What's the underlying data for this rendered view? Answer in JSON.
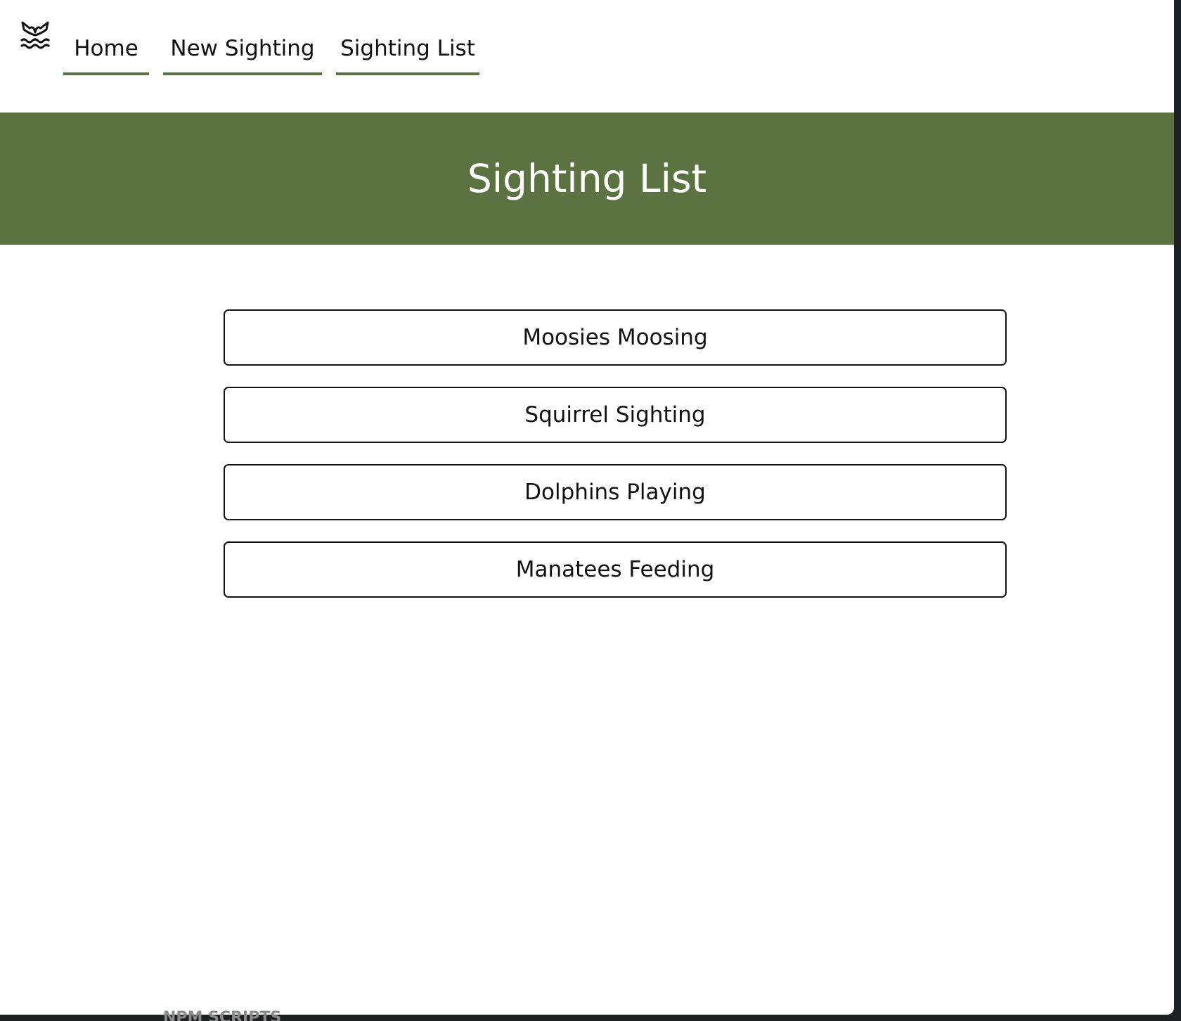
{
  "nav": {
    "logo_icon": "whale-tail-waves-icon",
    "links": [
      {
        "label": "Home"
      },
      {
        "label": "New Sighting"
      },
      {
        "label": "Sighting List"
      }
    ],
    "accent_color": "#5a7340"
  },
  "hero": {
    "title": "Sighting List",
    "background_color": "#5a7340"
  },
  "sightings": [
    {
      "label": "Moosies Moosing"
    },
    {
      "label": "Squirrel Sighting"
    },
    {
      "label": "Dolphins Playing"
    },
    {
      "label": "Manatees Feeding"
    }
  ],
  "taskbar": {
    "partial_text": "NPM SCRIPTS"
  }
}
